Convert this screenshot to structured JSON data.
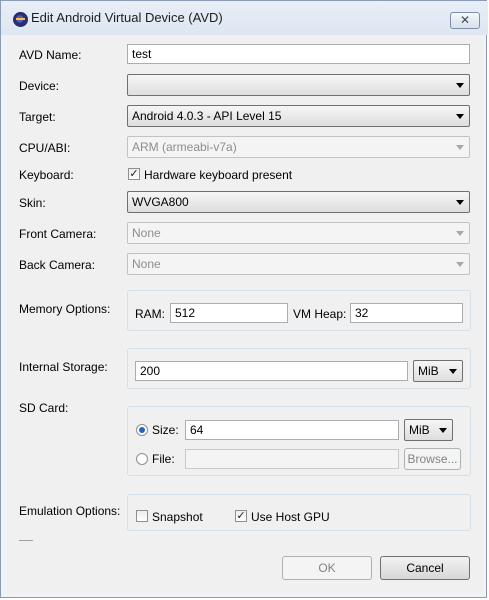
{
  "window": {
    "title": "Edit Android Virtual Device (AVD)",
    "close_glyph": "✕"
  },
  "form": {
    "avd_name": {
      "label": "AVD Name:",
      "value": "test"
    },
    "device": {
      "label": "Device:",
      "value": ""
    },
    "target": {
      "label": "Target:",
      "value": "Android 4.0.3 - API Level 15"
    },
    "cpu_abi": {
      "label": "CPU/ABI:",
      "value": "ARM (armeabi-v7a)"
    },
    "keyboard": {
      "label": "Keyboard:",
      "checkbox_label": "Hardware keyboard present",
      "checked": true
    },
    "skin": {
      "label": "Skin:",
      "value": "WVGA800"
    },
    "front_camera": {
      "label": "Front Camera:",
      "value": "None"
    },
    "back_camera": {
      "label": "Back Camera:",
      "value": "None"
    },
    "memory": {
      "label": "Memory Options:",
      "ram_label": "RAM:",
      "ram_value": "512",
      "vm_heap_label": "VM Heap:",
      "vm_heap_value": "32"
    },
    "internal_storage": {
      "label": "Internal Storage:",
      "value": "200",
      "unit": "MiB"
    },
    "sd_card": {
      "label": "SD Card:",
      "size_label": "Size:",
      "size_value": "64",
      "size_unit": "MiB",
      "size_selected": true,
      "file_label": "File:",
      "file_value": "",
      "browse_label": "Browse..."
    },
    "emulation": {
      "label": "Emulation Options:",
      "snapshot_label": "Snapshot",
      "snapshot_checked": false,
      "host_gpu_label": "Use Host GPU",
      "host_gpu_checked": true
    }
  },
  "buttons": {
    "ok": "OK",
    "cancel": "Cancel"
  },
  "glyphs": {
    "check": "✓"
  }
}
